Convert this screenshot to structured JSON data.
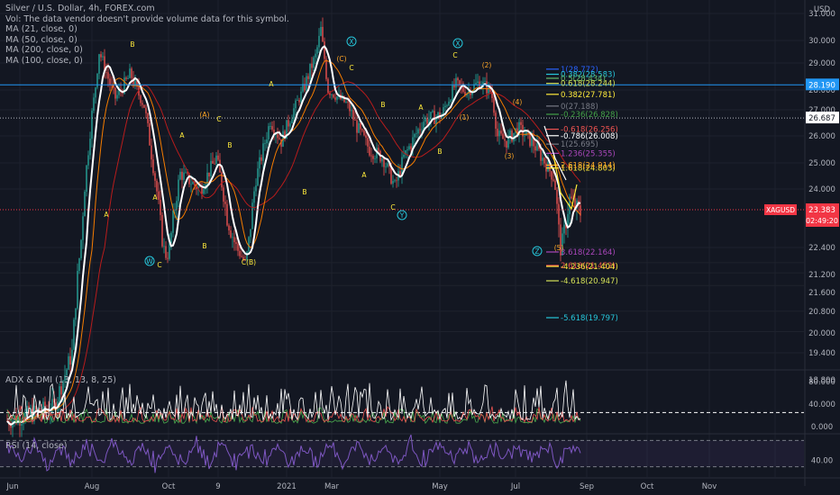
{
  "header": {
    "title": "Silver / U.S. Dollar, 4h, FOREX.com",
    "volume_note": "Vol: The data vendor doesn't provide volume data for this symbol.",
    "ma_lines": [
      "MA (21, close, 0)",
      "MA (50, close, 0)",
      "MA (200, close, 0)",
      "MA (100, close, 0)"
    ],
    "currency": "USD"
  },
  "price_axis": {
    "ticks": [
      "31.000",
      "30.000",
      "29.000",
      "28.000",
      "27.000",
      "26.000",
      "25.000",
      "24.000",
      "22.400",
      "21.200",
      "21.600",
      "20.800",
      "20.000",
      "19.400",
      "18.800"
    ],
    "tick_values": [
      31.0,
      30.0,
      29.0,
      28.0,
      27.0,
      26.0,
      25.0,
      24.0,
      22.4,
      21.2,
      21.6,
      20.8,
      20.0,
      19.4,
      18.8
    ],
    "label_28190": "28.190",
    "label_26687": "26.687",
    "symbol_tag": "XAGUSD",
    "last_price": "23.383",
    "countdown": "02:49:20"
  },
  "time_axis": {
    "labels": [
      "Jun",
      "Aug",
      "Oct",
      "9",
      "2021",
      "Mar",
      "May",
      "Jul",
      "Sep",
      "Oct",
      "Nov"
    ]
  },
  "fib_levels": [
    {
      "label": "1(28.772)",
      "value": 28.772,
      "color": "#2962ff"
    },
    {
      "label": "0.382(28.583)",
      "value": 28.583,
      "color": "#26c6da"
    },
    {
      "label": "0.5(28.434)",
      "value": 28.434,
      "color": "#66bb6a"
    },
    {
      "label": "0.618(28.244)",
      "value": 28.244,
      "color": "#d4e157"
    },
    {
      "label": "0.382(27.781)",
      "value": 27.781,
      "color": "#ffeb3b"
    },
    {
      "label": "0(27.188)",
      "value": 27.188,
      "color": "#787b86"
    },
    {
      "label": "-0.236(26.828)",
      "value": 26.828,
      "color": "#43a047"
    },
    {
      "label": "-0.618(26.256)",
      "value": 26.256,
      "color": "#ef5350"
    },
    {
      "label": "-0.786(26.008)",
      "value": 26.008,
      "color": "#ffffff"
    },
    {
      "label": "1(25.695)",
      "value": 25.695,
      "color": "#787b86"
    },
    {
      "label": "1.236(25.355)",
      "value": 25.355,
      "color": "#ab47bc"
    },
    {
      "label": "1.618(24.803)",
      "value": 24.803,
      "color": "#ffeb3b"
    },
    {
      "label": "2.618(24.914)",
      "value": 24.914,
      "color": "#ffa726"
    },
    {
      "label": "2.618(21.452)",
      "value": 21.452,
      "color": "#ef5350"
    },
    {
      "label": "3.618(22.164)",
      "value": 22.164,
      "color": "#ab47bc"
    },
    {
      "label": "-4.236(21.404)",
      "value": 21.404,
      "color": "#ffeb3b"
    },
    {
      "label": "-4.618(20.947)",
      "value": 20.947,
      "color": "#d4e157"
    },
    {
      "label": "-5.618(19.797)",
      "value": 19.797,
      "color": "#26c6da"
    }
  ],
  "wave_labels": [
    {
      "text": "B",
      "color": "#ffeb3b"
    },
    {
      "text": "A",
      "color": "#ffeb3b"
    },
    {
      "text": "(A)",
      "color": "#ffa726"
    },
    {
      "text": "C",
      "color": "#ffeb3b"
    },
    {
      "text": "A",
      "color": "#ffeb3b"
    },
    {
      "text": "B",
      "color": "#ffeb3b"
    },
    {
      "text": "W",
      "color": "#26c6da"
    },
    {
      "text": "C",
      "color": "#ffeb3b"
    },
    {
      "text": "A",
      "color": "#ffeb3b"
    },
    {
      "text": "B",
      "color": "#ffeb3b"
    },
    {
      "text": "C(B)",
      "color": "#ffeb3b"
    },
    {
      "text": "A",
      "color": "#ffeb3b"
    },
    {
      "text": "B",
      "color": "#ffeb3b"
    },
    {
      "text": "(C)",
      "color": "#ffa726"
    },
    {
      "text": "C",
      "color": "#ffeb3b"
    },
    {
      "text": "X",
      "color": "#26c6da"
    },
    {
      "text": "B",
      "color": "#ffeb3b"
    },
    {
      "text": "A",
      "color": "#ffeb3b"
    },
    {
      "text": "C",
      "color": "#ffeb3b"
    },
    {
      "text": "Y",
      "color": "#26c6da"
    },
    {
      "text": "A",
      "color": "#ffeb3b"
    },
    {
      "text": "X",
      "color": "#26c6da"
    },
    {
      "text": "C",
      "color": "#ffeb3b"
    },
    {
      "text": "(2)",
      "color": "#ffa726"
    },
    {
      "text": "(1)",
      "color": "#ffa726"
    },
    {
      "text": "B",
      "color": "#ffeb3b"
    },
    {
      "text": "(4)",
      "color": "#ffa726"
    },
    {
      "text": "(3)",
      "color": "#ffa726"
    },
    {
      "text": "(5)",
      "color": "#ffa726"
    },
    {
      "text": "Z",
      "color": "#26c6da"
    }
  ],
  "adx_panel": {
    "label": "ADX & DMI (13, 13, 8, 25)",
    "ticks": [
      "80.000",
      "40.000",
      "0.000"
    ],
    "tick_values": [
      80,
      40,
      0
    ],
    "threshold": 25
  },
  "rsi_panel": {
    "label": "RSI (14, close)",
    "ticks": [
      "40.00"
    ],
    "tick_values": [
      40
    ],
    "bands": [
      70,
      30
    ]
  },
  "colors": {
    "background": "#131722",
    "up": "#26a69a",
    "down": "#ef5350",
    "ma21": "#ffffff",
    "ma50": "#f57c00",
    "ma100": "#b71c1c",
    "rsi": "#7e57c2",
    "adx": "#ffffff",
    "di_plus": "#4caf50",
    "di_minus": "#ef5350",
    "hline_blue": "#2196f3",
    "tag_red": "#f23645"
  }
}
